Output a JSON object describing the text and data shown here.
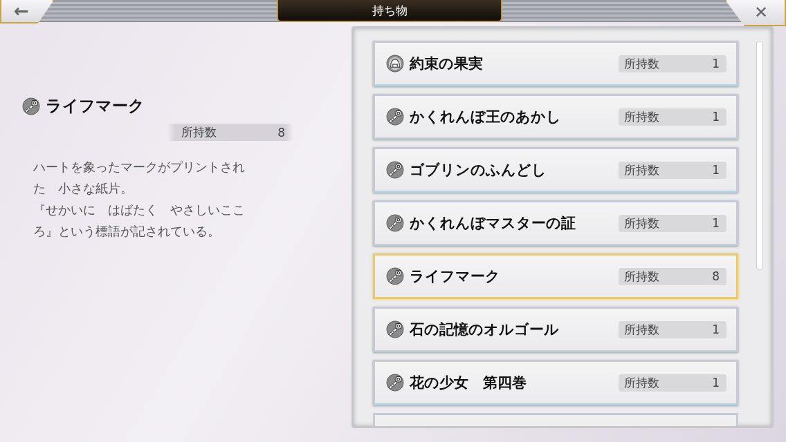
{
  "header": {
    "back_label": "←",
    "title": "持ち物",
    "close_label": "✕"
  },
  "detail": {
    "kind": "key",
    "name": "ライフマーク",
    "count_label": "所持数",
    "count": "8",
    "description": [
      "ハートを象ったマークがプリントされた　小さな紙片。",
      "『せかいに　はばたく　やさしいこころ』という標語が記されている。"
    ]
  },
  "items": [
    {
      "kind": "fruit",
      "name": "約束の果実",
      "count_label": "所持数",
      "count": "1",
      "selected": false
    },
    {
      "kind": "key",
      "name": "かくれんぼ王のあかし",
      "count_label": "所持数",
      "count": "1",
      "selected": false
    },
    {
      "kind": "key",
      "name": "ゴブリンのふんどし",
      "count_label": "所持数",
      "count": "1",
      "selected": false
    },
    {
      "kind": "key",
      "name": "かくれんぼマスターの証",
      "count_label": "所持数",
      "count": "1",
      "selected": false
    },
    {
      "kind": "key",
      "name": "ライフマーク",
      "count_label": "所持数",
      "count": "8",
      "selected": true
    },
    {
      "kind": "key",
      "name": "石の記憶のオルゴール",
      "count_label": "所持数",
      "count": "1",
      "selected": false
    },
    {
      "kind": "key",
      "name": "花の少女　第四巻",
      "count_label": "所持数",
      "count": "1",
      "selected": false
    }
  ]
}
